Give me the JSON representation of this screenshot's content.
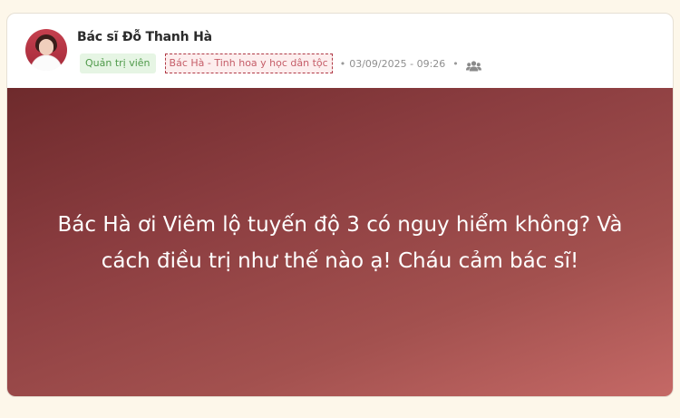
{
  "post": {
    "author_name": "Bác sĩ Đỗ Thanh Hà",
    "role_badge": "Quản trị viên",
    "group_badge": "Bác Hà - Tinh hoa y học dân tộc",
    "separator": "•",
    "timestamp": "03/09/2025 - 09:26",
    "audience_icon": "group-icon",
    "content_text": "Bác Hà ơi Viêm lộ tuyến độ 3 có nguy hiểm không? Và cách điều trị như thế nào ạ! Cháu cảm bác sĩ!"
  },
  "colors": {
    "page_bg": "#fdf7ea",
    "card_bg": "#ffffff",
    "hero_gradient_start": "#6e2a2c",
    "hero_gradient_end": "#c56966",
    "admin_badge_bg": "#e6f5e4",
    "admin_badge_text": "#4f9a4a",
    "group_badge_bg": "#fdeeee",
    "group_badge_text": "#c55d68"
  }
}
